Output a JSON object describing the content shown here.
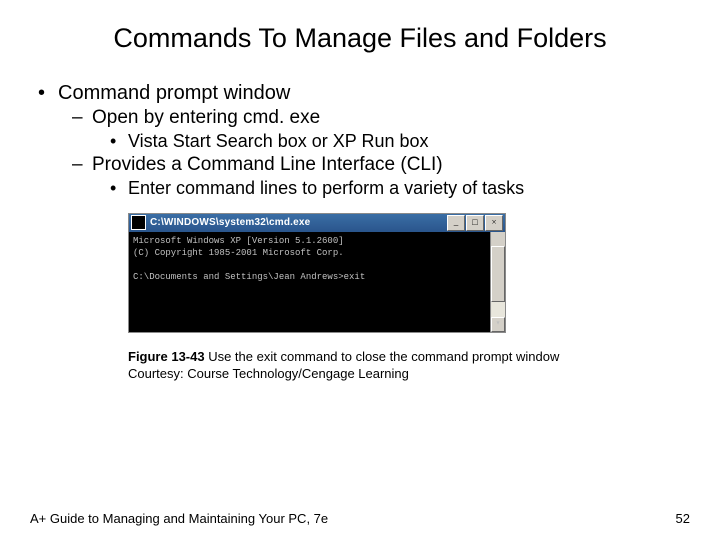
{
  "title": "Commands To Manage Files and Folders",
  "bullets": {
    "l1": "Command prompt window",
    "l2a": "Open by entering cmd. exe",
    "l3a": "Vista Start Search box or XP Run box",
    "l2b": "Provides a Command Line Interface (CLI)",
    "l3b": "Enter command lines to perform a variety of tasks"
  },
  "cmd": {
    "title": "C:\\WINDOWS\\system32\\cmd.exe",
    "line1": "Microsoft Windows XP [Version 5.1.2600]",
    "line2": "(C) Copyright 1985-2001 Microsoft Corp.",
    "line3": "",
    "line4": "C:\\Documents and Settings\\Jean Andrews>exit"
  },
  "caption": {
    "fig": "Figure 13-43",
    "text": " Use the exit command to close the command prompt window",
    "courtesy": "Courtesy: Course Technology/Cengage Learning"
  },
  "footer": {
    "left": "A+ Guide to Managing and Maintaining Your PC, 7e",
    "right": "52"
  }
}
